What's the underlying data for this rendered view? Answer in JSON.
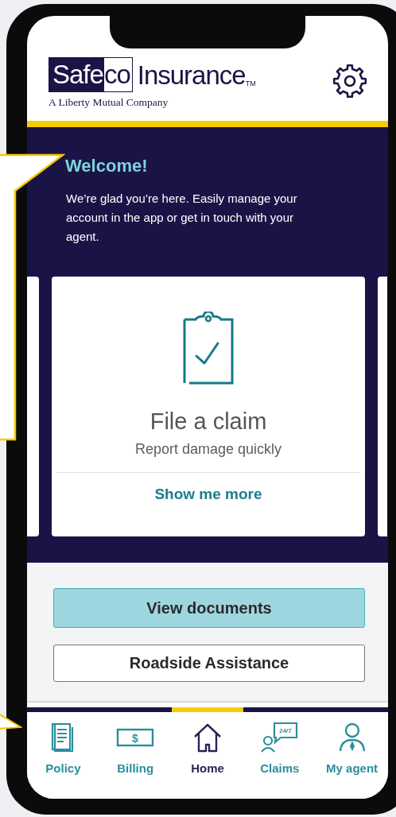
{
  "header": {
    "logo": {
      "boxed_dark": "Safe",
      "boxed_light": "co",
      "rest": "Insurance",
      "trademark": "TM",
      "tagline": "A Liberty Mutual Company"
    }
  },
  "welcome": {
    "title": "Welcome!",
    "message": "We’re glad you’re here. Easily manage your account in the app or get in touch with your agent."
  },
  "cards": [
    {
      "kind": "partial"
    },
    {
      "kind": "feature",
      "title": "File a claim",
      "subtitle": "Report damage quickly",
      "link": "Show me more"
    },
    {
      "kind": "partial"
    }
  ],
  "actions": [
    {
      "kind": "primary",
      "label": "View documents"
    },
    {
      "kind": "secondary",
      "label": "Roadside Assistance"
    }
  ],
  "tab_bar": [
    {
      "kind": "policy",
      "label": "Policy",
      "selected": false
    },
    {
      "kind": "billing",
      "label": "Billing",
      "icon_text": "$",
      "selected": false
    },
    {
      "kind": "home",
      "label": "Home",
      "selected": true
    },
    {
      "kind": "claims",
      "label": "Claims",
      "icon_text": "24/7",
      "selected": false
    },
    {
      "kind": "agent",
      "label": "My agent",
      "selected": false
    }
  ]
}
